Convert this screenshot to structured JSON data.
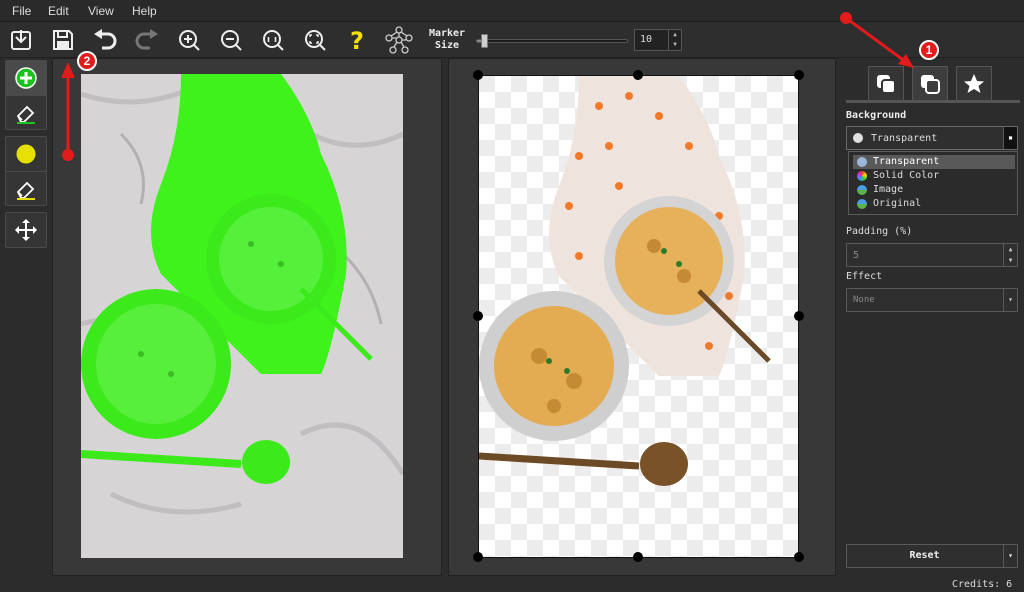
{
  "menu": [
    "File",
    "Edit",
    "View",
    "Help"
  ],
  "toolbar": {
    "marker_label": "Marker Size",
    "marker_size": "10",
    "marker_fraction": 0.03
  },
  "sidebar": {
    "background_label": "Background",
    "background_value": "Transparent",
    "background_options": [
      "Transparent",
      "Solid Color",
      "Image",
      "Original"
    ],
    "padding_label": "Padding (%)",
    "padding_value": "5",
    "effect_label": "Effect",
    "effect_value": "None",
    "reset_label": "Reset"
  },
  "status": {
    "credits": "Credits: 6"
  },
  "annotations": {
    "badge1": "1",
    "badge2": "2"
  },
  "colors": {
    "accent_green": "#19c31d",
    "marker_yellow": "#e5e000",
    "annotation_red": "#e21b1b",
    "mask_green": "#3ff21c"
  },
  "icons": {
    "primary_tools": [
      "plus-circle-icon",
      "eraser-icon",
      "yellow-circle-icon",
      "eraser-yellow-icon",
      "move-icon"
    ]
  }
}
